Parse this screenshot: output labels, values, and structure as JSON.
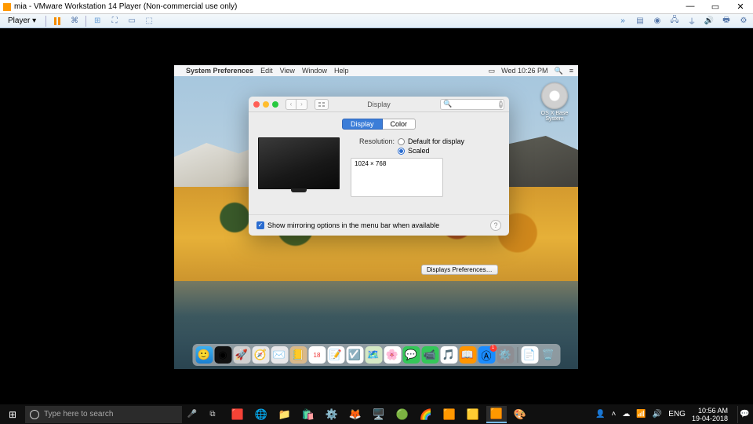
{
  "host": {
    "title": "mia - VMware Workstation 14 Player (Non-commercial use only)",
    "player_menu": "Player",
    "taskbar": {
      "search_placeholder": "Type here to search",
      "lang": "ENG",
      "time": "10:56 AM",
      "date": "19-04-2018"
    }
  },
  "mac": {
    "menubar": {
      "app": "System Preferences",
      "items": [
        "Edit",
        "View",
        "Window",
        "Help"
      ],
      "clock": "Wed 10:26 PM"
    },
    "desktop_icon": "OS X Base System",
    "pref": {
      "title": "Display",
      "tabs": {
        "display": "Display",
        "color": "Color"
      },
      "resolution_label": "Resolution:",
      "radio_default": "Default for display",
      "radio_scaled": "Scaled",
      "resolutions": [
        "1024 × 768"
      ],
      "mirror_checkbox": "Show mirroring options in the menu bar when available",
      "search_value": ""
    },
    "ghost_button": "Displays Preferences…",
    "dock_badge": "1"
  }
}
